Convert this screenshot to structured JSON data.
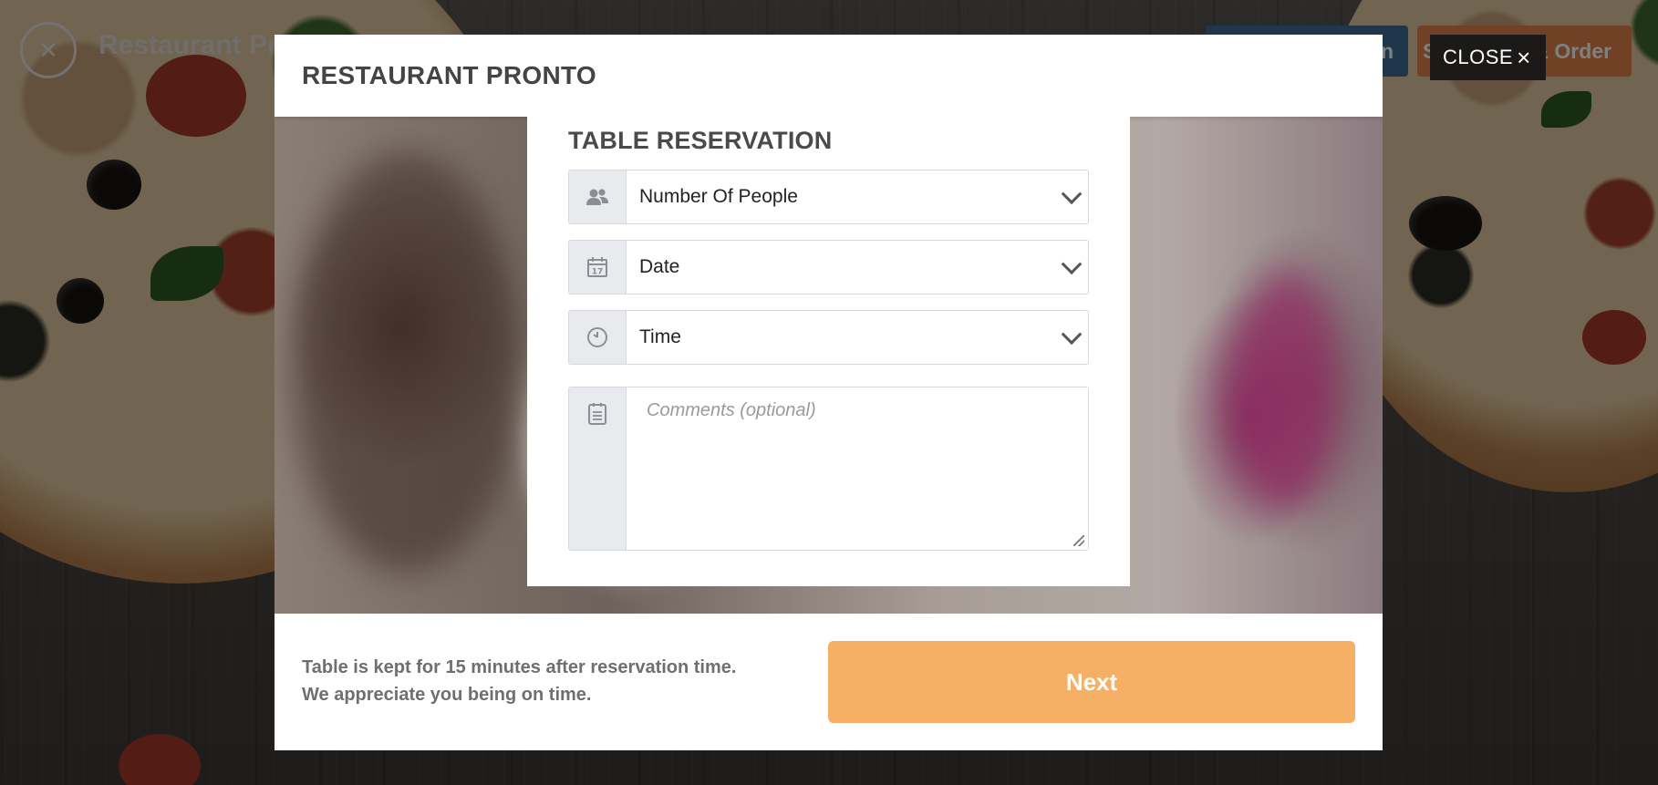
{
  "site": {
    "name": "Restaurant Pronto",
    "header_buttons": [
      {
        "label": "Reservation",
        "icon": "calendar-icon"
      },
      {
        "label": "See MENU & Order",
        "icon": "menu-icon"
      }
    ]
  },
  "close_label": "CLOSE",
  "close_icon": "×",
  "modal": {
    "title": "RESTAURANT PRONTO",
    "form": {
      "title": "TABLE RESERVATION",
      "people": {
        "value": "Number Of People",
        "icon": "people-icon"
      },
      "date": {
        "value": "Date",
        "icon": "calendar-icon"
      },
      "time": {
        "value": "Time",
        "icon": "clock-icon"
      },
      "comments": {
        "placeholder": "Comments (optional)",
        "icon": "notepad-icon"
      }
    },
    "footer": {
      "policy_line1": "Table is kept for 15 minutes after reservation time.",
      "policy_line2": "We appreciate you being on time.",
      "next_label": "Next"
    }
  },
  "colors": {
    "accent_next": "#f5b066",
    "header_blue": "#3f6d97",
    "header_orange": "#e2834a"
  }
}
